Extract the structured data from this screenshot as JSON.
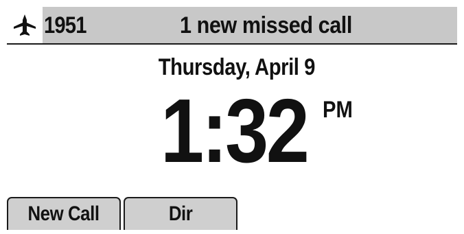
{
  "status_bar": {
    "line_icon": "airplane-icon",
    "line_number": "1951",
    "message": "1 new missed call"
  },
  "idle_screen": {
    "date": "Thursday, April 9",
    "time": "1:32",
    "ampm": "PM"
  },
  "softkeys": [
    {
      "label": "New Call"
    },
    {
      "label": "Dir"
    }
  ]
}
